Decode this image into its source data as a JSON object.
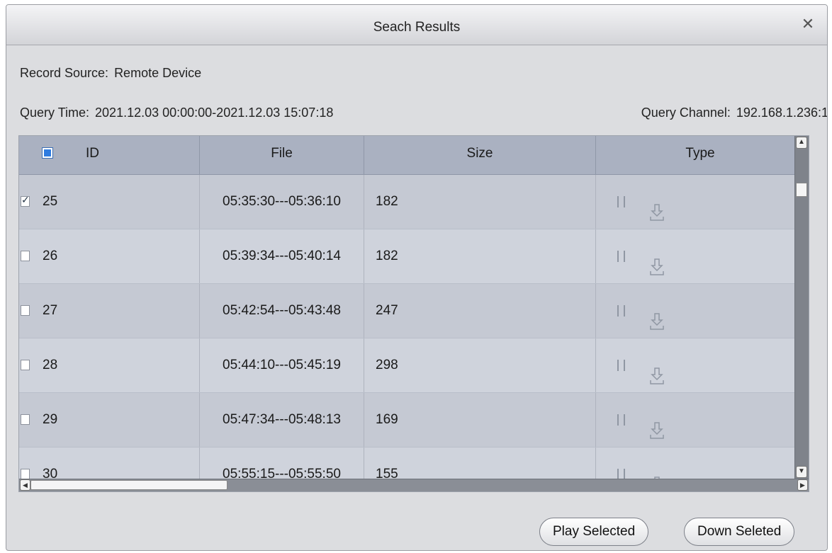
{
  "dialog": {
    "title": "Seach Results",
    "close_glyph": "✕"
  },
  "info": {
    "record_source_label": "Record Source:",
    "record_source_value": "Remote Device",
    "query_time_label": "Query Time:",
    "query_time_value": "2021.12.03 00:00:00-2021.12.03 15:07:18",
    "query_channel_label": "Query Channel:",
    "query_channel_value": "192.168.1.236:1"
  },
  "table": {
    "columns": [
      "ID",
      "File",
      "Size",
      "Type"
    ],
    "header_checked": true,
    "rows": [
      {
        "id": "25",
        "file": "05:35:30---05:36:10",
        "size": "182",
        "checked": true
      },
      {
        "id": "26",
        "file": "05:39:34---05:40:14",
        "size": "182",
        "checked": false
      },
      {
        "id": "27",
        "file": "05:42:54---05:43:48",
        "size": "247",
        "checked": false
      },
      {
        "id": "28",
        "file": "05:44:10---05:45:19",
        "size": "298",
        "checked": false
      },
      {
        "id": "29",
        "file": "05:47:34---05:48:13",
        "size": "169",
        "checked": false
      },
      {
        "id": "30",
        "file": "05:55:15---05:55:50",
        "size": "155",
        "checked": false
      }
    ],
    "type_icons": [
      "pause-icon",
      "download-icon"
    ]
  },
  "buttons": {
    "play_selected": "Play Selected",
    "down_selected": "Down Seleted"
  },
  "colors": {
    "dialog_bg": "#dcdde0",
    "header_bg": "#aab1c1",
    "checkbox_accent": "#2f7ce0"
  }
}
